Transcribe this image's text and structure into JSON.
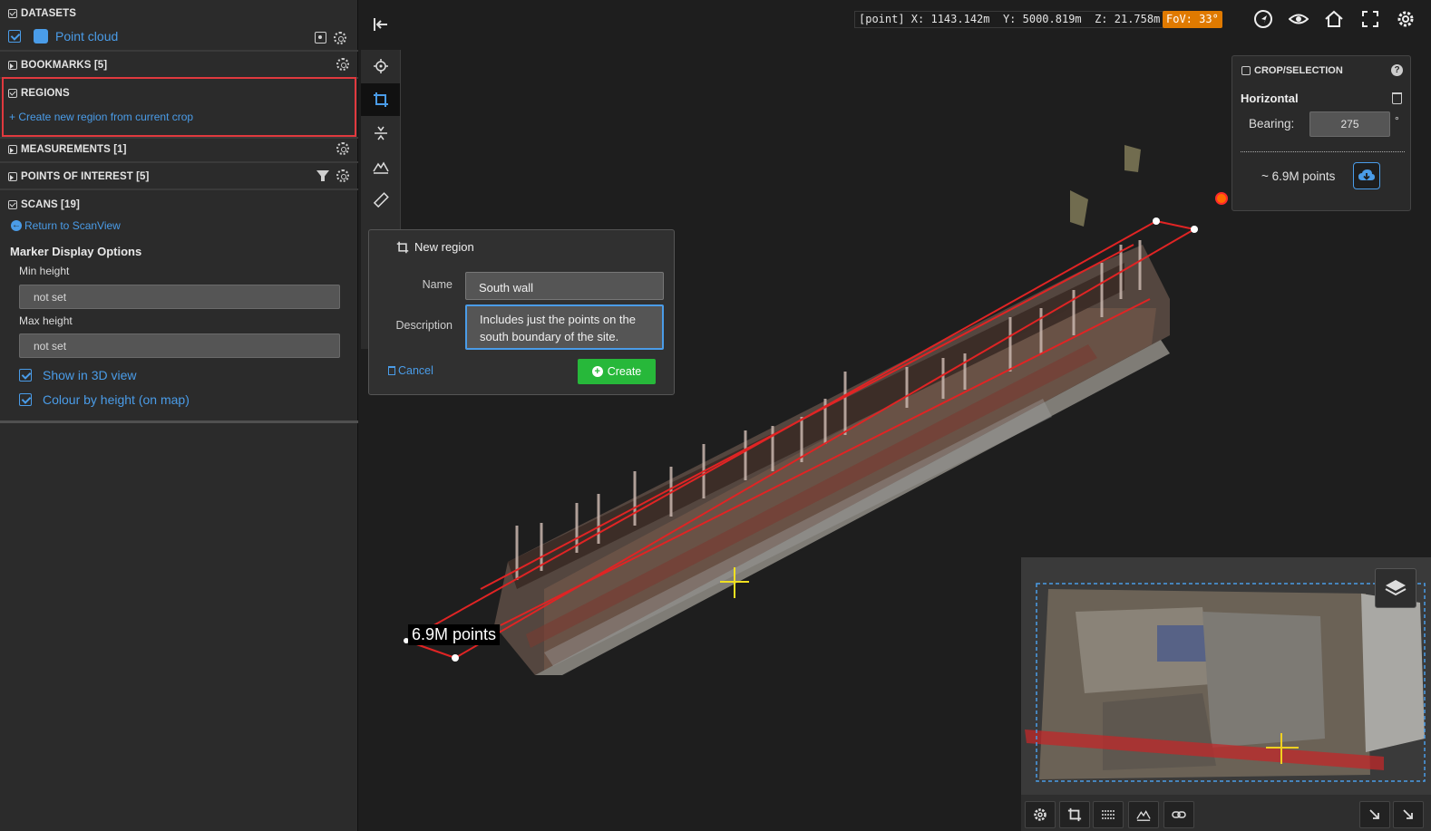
{
  "sidebar": {
    "datasets": {
      "title": "DATASETS",
      "item": "Point cloud"
    },
    "bookmarks": {
      "title": "BOOKMARKS [5]"
    },
    "regions": {
      "title": "REGIONS",
      "create_link": "+ Create new region from current crop"
    },
    "measurements": {
      "title": "MEASUREMENTS [1]"
    },
    "poi": {
      "title": "POINTS OF INTEREST [5]"
    },
    "scans": {
      "title": "SCANS [19]",
      "return_link": "Return to ScanView",
      "options_title": "Marker Display Options",
      "min_height_label": "Min height",
      "min_height_value": "not set",
      "max_height_label": "Max height",
      "max_height_value": "not set",
      "show_3d_label": "Show in 3D view",
      "colour_height_label": "Colour by height (on map)"
    }
  },
  "dialog": {
    "title": "New region",
    "name_label": "Name",
    "name_value": "South wall",
    "description_label": "Description",
    "description_value": "Includes just the points on the south boundary of the site.",
    "cancel_label": "Cancel",
    "create_label": "Create"
  },
  "topbar": {
    "coords": "[point] X: 1143.142m  Y: 5000.819m  Z: 21.758m",
    "fov": "FoV: 33°"
  },
  "crop_panel": {
    "title": "CROP/SELECTION",
    "help": "?",
    "mode": "Horizontal",
    "bearing_label": "Bearing:",
    "bearing_value": "275",
    "degree": "°",
    "points": "~ 6.9M points"
  },
  "viewport": {
    "points_label": "6.9M points"
  },
  "colors": {
    "accent_blue": "#4a9ce8",
    "create_green": "#27b83a",
    "fov_orange": "#e07a00",
    "crop_red": "#e02424",
    "highlight_red": "#e0393e"
  }
}
